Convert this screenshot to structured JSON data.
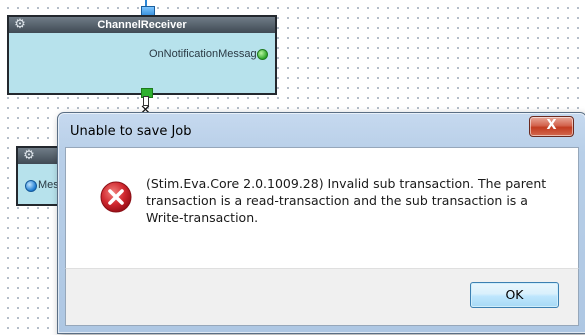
{
  "canvas": {
    "node1": {
      "title": "ChannelReceiver",
      "port_label": "OnNotificationMessage",
      "header_icon": "gear-icon",
      "port_icon": "green-port-icon"
    },
    "node2": {
      "port_label": "Mes",
      "header_icon": "gear-icon",
      "port_icon": "blue-port-icon"
    }
  },
  "dialog": {
    "title": "Unable to save Job",
    "close_label": "X",
    "icon": "error-icon",
    "message": "(Stim.Eva.Core 2.0.1009.28) Invalid sub transaction. The parent transaction is a read-transaction and the sub transaction is a Write-transaction.",
    "ok_label": "OK"
  },
  "colors": {
    "node_body": "#b7e2ec",
    "node_header": "#3f4a54",
    "dialog_frame": "#b8cfe8",
    "close_button": "#c23b20",
    "error_icon": "#c8242b"
  }
}
